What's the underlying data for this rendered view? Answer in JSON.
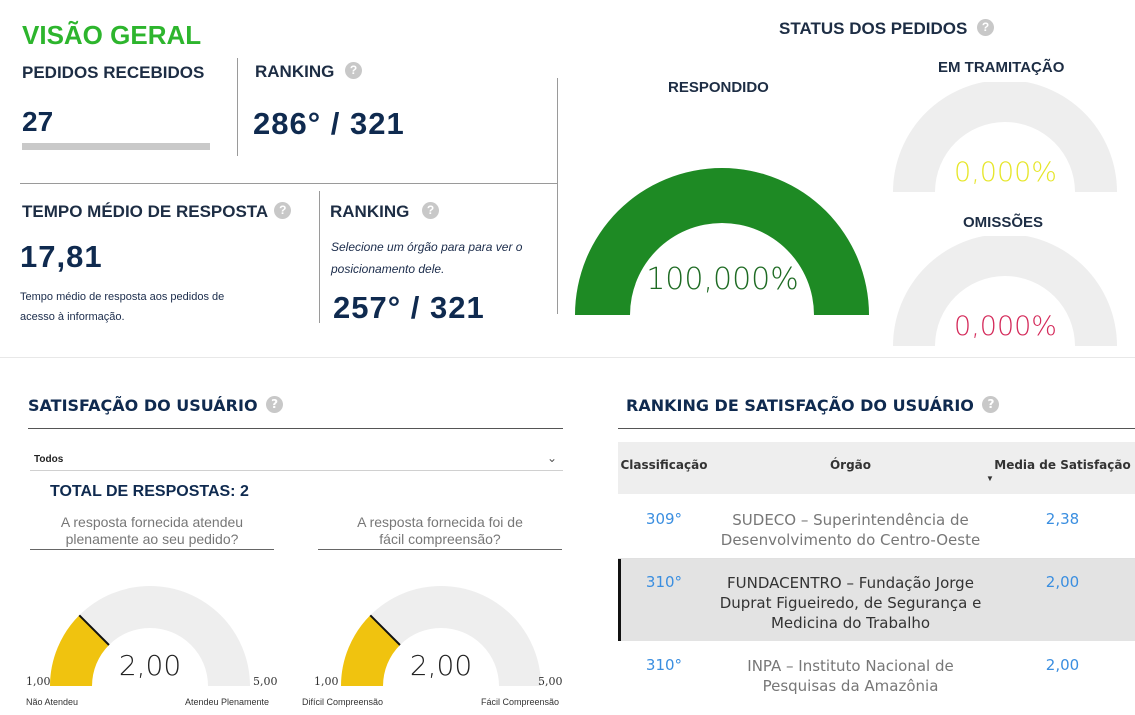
{
  "overview": {
    "title": "VISÃO GERAL",
    "received_label": "PEDIDOS RECEBIDOS",
    "received_value": "27",
    "received_progress": 1.0,
    "ranking_label": "RANKING",
    "ranking_value": "286° / 321",
    "avg_time_label": "TEMPO MÉDIO DE RESPOSTA",
    "avg_time_value": "17,81",
    "avg_time_desc_line1": "Tempo médio de resposta aos pedidos de",
    "avg_time_desc_line2": "acesso à informação.",
    "ranking2_label": "RANKING",
    "ranking2_hint_line1": "Selecione um órgão para para ver o",
    "ranking2_hint_line2": "posicionamento dele.",
    "ranking2_value": "257° / 321",
    "help_glyph": "?"
  },
  "status": {
    "title": "STATUS DOS PEDIDOS",
    "responded": {
      "label": "RESPONDIDO",
      "value": "100,000%",
      "fraction": 1.0,
      "color": "#1e8a24"
    },
    "in_progress": {
      "label": "EM TRAMITAÇÃO",
      "value": "0,000%",
      "fraction": 0.0,
      "color": "#e6e62a"
    },
    "omissions": {
      "label": "OMISSÕES",
      "value": "0,000%",
      "fraction": 0.0,
      "color": "#d42a5a"
    }
  },
  "satisfaction": {
    "title": "SATISFAÇÃO DO USUÁRIO",
    "filter_value": "Todos",
    "total_label": "TOTAL DE RESPOSTAS: 2",
    "q1_line1": "A resposta fornecida atendeu",
    "q1_line2": "plenamente ao seu pedido?",
    "q2_line1": "A resposta fornecida foi de",
    "q2_line2": "fácil compreensão?",
    "gauge1": {
      "value": "2,00",
      "numeric": 2.0,
      "min": "1,00",
      "max": "5,00",
      "left_label": "Não Atendeu",
      "right_label": "Atendeu Plenamente"
    },
    "gauge2": {
      "value": "2,00",
      "numeric": 2.0,
      "min": "1,00",
      "max": "5,00",
      "left_label": "Difícil Compreensão",
      "right_label": "Fácil Compreensão"
    },
    "gauge_color": "#f0c30f"
  },
  "ranking_table": {
    "title": "RANKING DE SATISFAÇÃO DO USUÁRIO",
    "headers": [
      "Classificação",
      "Órgão",
      "Media de Satisfação"
    ],
    "rows": [
      {
        "rank": "309°",
        "org_line1": "SUDECO – Superintendência de",
        "org_line2": "Desenvolvimento do Centro-Oeste",
        "org_line3": "",
        "score": "2,38"
      },
      {
        "rank": "310°",
        "org_line1": "FUNDACENTRO – Fundação Jorge",
        "org_line2": "Duprat Figueiredo, de Segurança e",
        "org_line3": "Medicina do Trabalho",
        "score": "2,00"
      },
      {
        "rank": "310°",
        "org_line1": "INPA – Instituto Nacional de",
        "org_line2": "Pesquisas da Amazônia",
        "org_line3": "",
        "score": "2,00"
      }
    ],
    "link_color": "#3a8ee0"
  }
}
